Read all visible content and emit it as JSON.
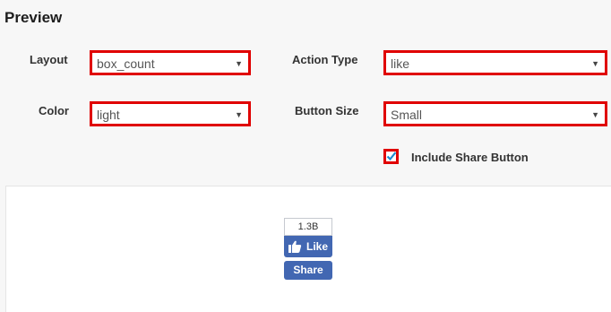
{
  "preview": {
    "title": "Preview"
  },
  "settings": {
    "layout": {
      "label": "Layout",
      "value": "box_count"
    },
    "action_type": {
      "label": "Action Type",
      "value": "like"
    },
    "color": {
      "label": "Color",
      "value": "light"
    },
    "button_size": {
      "label": "Button Size",
      "value": "Small"
    },
    "include_share": {
      "label": "Include Share Button",
      "checked": true
    }
  },
  "widget": {
    "count": "1.3B",
    "like_label": "Like",
    "share_label": "Share",
    "brand_color": "#4267b2"
  },
  "colors": {
    "highlight": "#e00000",
    "checkmark": "#1e8bd0"
  }
}
